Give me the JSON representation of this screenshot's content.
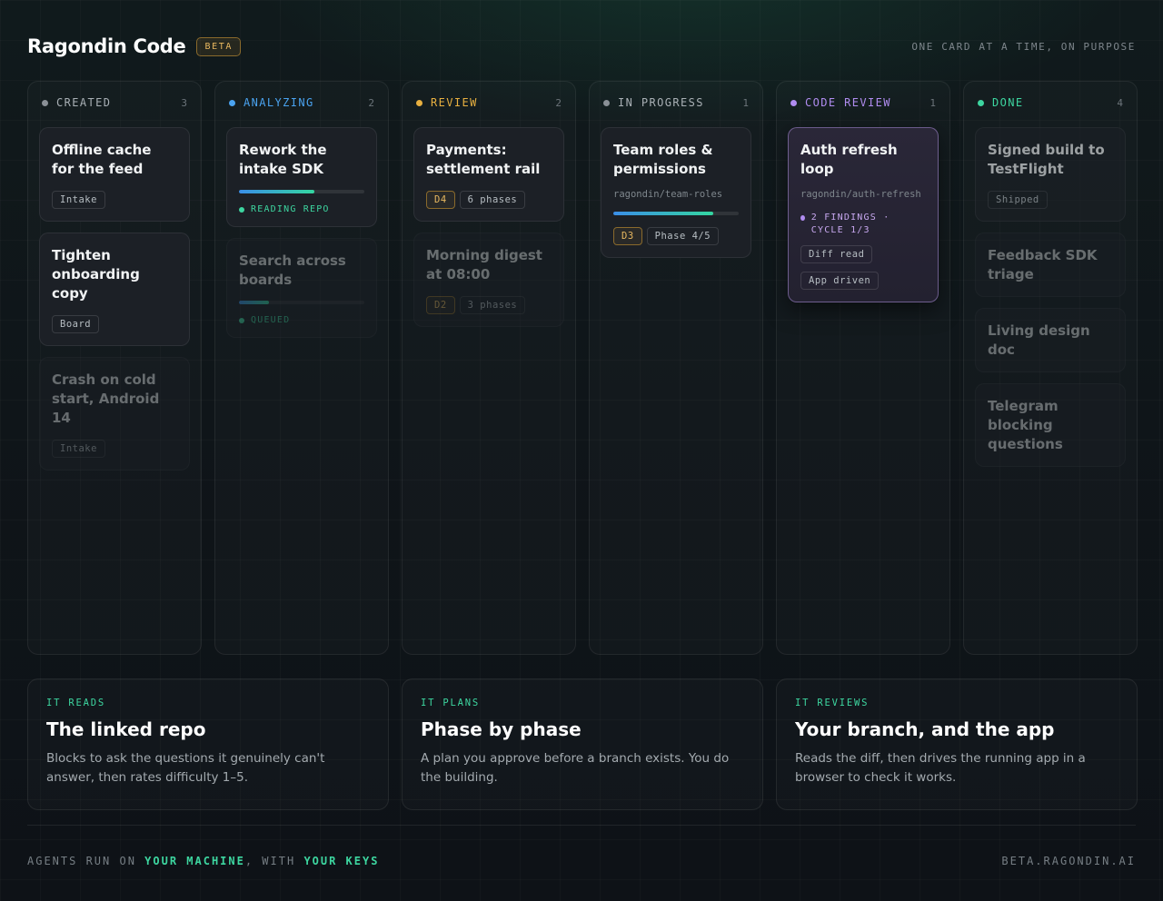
{
  "header": {
    "brand": "Ragondin Code",
    "beta_badge": "BETA",
    "tagline": "ONE CARD AT A TIME, ON PURPOSE"
  },
  "colors": {
    "created": "#8a9096",
    "analyzing": "#4aa3f0",
    "review": "#e8b040",
    "in_progress": "#8a9096",
    "code_review": "#b08cf0",
    "done": "#3dd6a0",
    "accent": "#3dd6a0"
  },
  "columns": {
    "created": {
      "title": "CREATED",
      "count": "3",
      "cards": [
        {
          "title": "Offline cache for the feed",
          "tag": "Intake"
        },
        {
          "title": "Tighten onboarding copy",
          "tag": "Board"
        },
        {
          "title": "Crash on cold start, Android 14",
          "tag": "Intake"
        }
      ]
    },
    "analyzing": {
      "title": "ANALYZING",
      "count": "2",
      "cards": [
        {
          "title": "Rework the intake SDK",
          "progress": 0.6,
          "status": "READING REPO"
        },
        {
          "title": "Search across boards",
          "progress": 0.24,
          "status": "QUEUED"
        }
      ]
    },
    "review": {
      "title": "REVIEW",
      "count": "2",
      "cards": [
        {
          "title": "Payments: settlement rail",
          "difficulty": "D4",
          "phases": "6 phases"
        },
        {
          "title": "Morning digest at 08:00",
          "difficulty": "D2",
          "phases": "3 phases"
        }
      ]
    },
    "in_progress": {
      "title": "IN PROGRESS",
      "count": "1",
      "cards": [
        {
          "title": "Team roles & permissions",
          "repo": "ragondin/team-roles",
          "progress": 0.8,
          "difficulty": "D3",
          "phase": "Phase 4/5"
        }
      ]
    },
    "code_review": {
      "title": "CODE REVIEW",
      "count": "1",
      "cards": [
        {
          "title": "Auth refresh loop",
          "repo": "ragondin/auth-refresh",
          "findings": "2 FINDINGS · CYCLE 1/3",
          "tag1": "Diff read",
          "tag2": "App driven"
        }
      ]
    },
    "done": {
      "title": "DONE",
      "count": "4",
      "cards": [
        {
          "title": "Signed build to TestFlight",
          "tag": "Shipped"
        },
        {
          "title": "Feedback SDK triage"
        },
        {
          "title": "Living design doc"
        },
        {
          "title": "Telegram blocking questions"
        }
      ]
    }
  },
  "features": [
    {
      "kicker": "IT READS",
      "title": "The linked repo",
      "desc": "Blocks to ask the questions it genuinely can't answer, then rates difficulty 1–5."
    },
    {
      "kicker": "IT PLANS",
      "title": "Phase by phase",
      "desc": "A plan you approve before a branch exists. You do the building."
    },
    {
      "kicker": "IT REVIEWS",
      "title": "Your branch, and the app",
      "desc": "Reads the diff, then drives the running app in a browser to check it works."
    }
  ],
  "footer": {
    "part1": "AGENTS RUN ON ",
    "hl1": "YOUR MACHINE",
    "part2": ", WITH ",
    "hl2": "YOUR KEYS",
    "site": "BETA.RAGONDIN.AI"
  }
}
